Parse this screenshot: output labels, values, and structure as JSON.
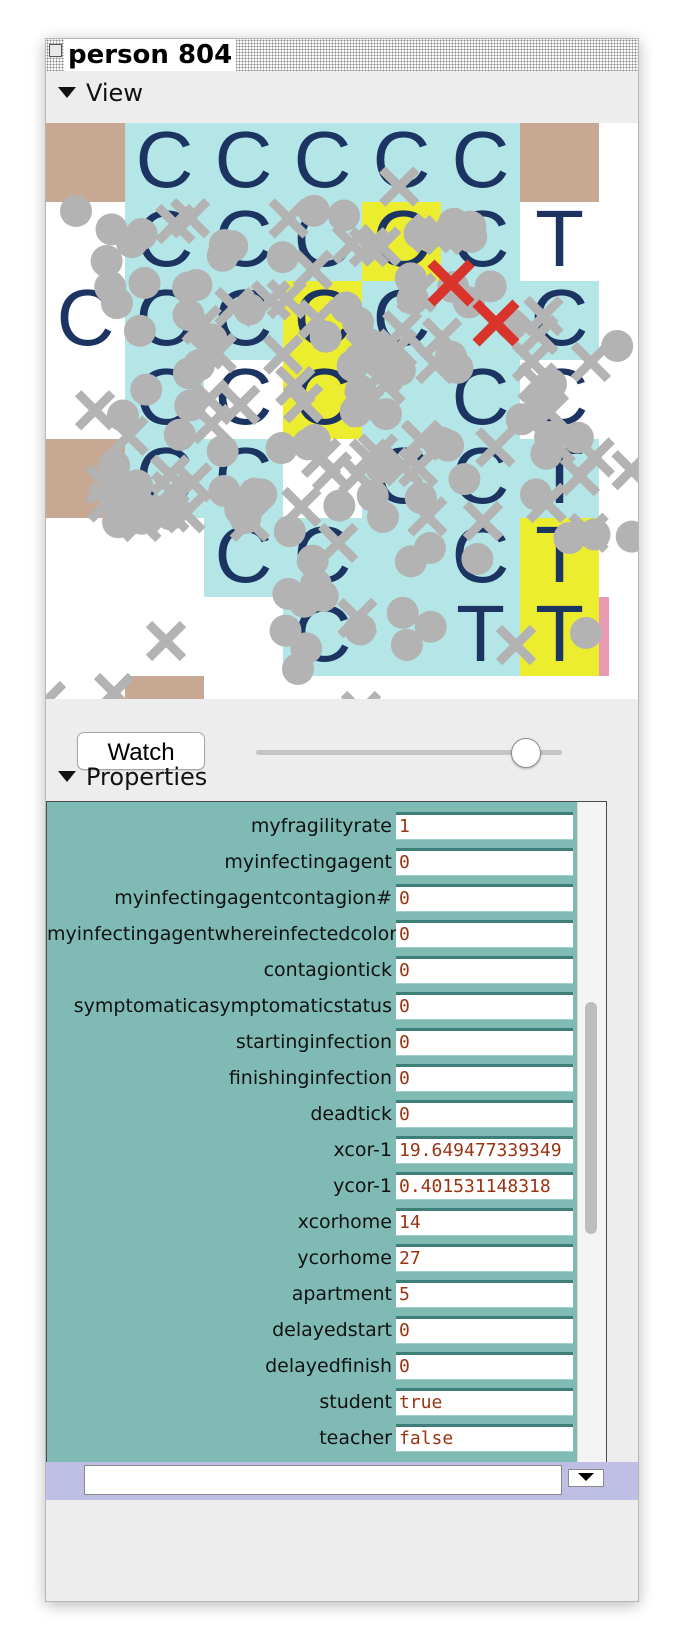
{
  "window": {
    "title": "person 804"
  },
  "view_section": {
    "label": "View"
  },
  "view_canvas": {
    "colors": {
      "beige": "#c7a893",
      "cyan": "#b4e6e7",
      "yellow": "#eded30",
      "navy": "#1b3461",
      "turtle_gray": "#b3b3b3",
      "infected_red": "#d9342b",
      "pink": "#e89ab0"
    },
    "glyphs": [
      "C",
      "T"
    ],
    "turtle_shapes": [
      "circle",
      "x"
    ]
  },
  "controls": {
    "watch_label": "Watch",
    "slider_level_fraction": 0.88
  },
  "properties_section": {
    "label": "Properties"
  },
  "properties": [
    {
      "name": "myfragilityrate",
      "value": "1"
    },
    {
      "name": "myinfectingagent",
      "value": "0"
    },
    {
      "name": "myinfectingagentcontagion#",
      "value": "0"
    },
    {
      "name": "myinfectingagentwhereinfectedcolor",
      "value": "0"
    },
    {
      "name": "contagiontick",
      "value": "0"
    },
    {
      "name": "symptomaticasymptomaticstatus",
      "value": "0"
    },
    {
      "name": "startinginfection",
      "value": "0"
    },
    {
      "name": "finishinginfection",
      "value": "0"
    },
    {
      "name": "deadtick",
      "value": "0"
    },
    {
      "name": "xcor-1",
      "value": "19.649477339349"
    },
    {
      "name": "ycor-1",
      "value": "0.401531148318"
    },
    {
      "name": "xcorhome",
      "value": "14"
    },
    {
      "name": "ycorhome",
      "value": "27"
    },
    {
      "name": "apartment",
      "value": "5"
    },
    {
      "name": "delayedstart",
      "value": "0"
    },
    {
      "name": "delayedfinish",
      "value": "0"
    },
    {
      "name": "student",
      "value": "true"
    },
    {
      "name": "teacher",
      "value": "false"
    }
  ],
  "command_bar": {
    "input_value": ""
  }
}
